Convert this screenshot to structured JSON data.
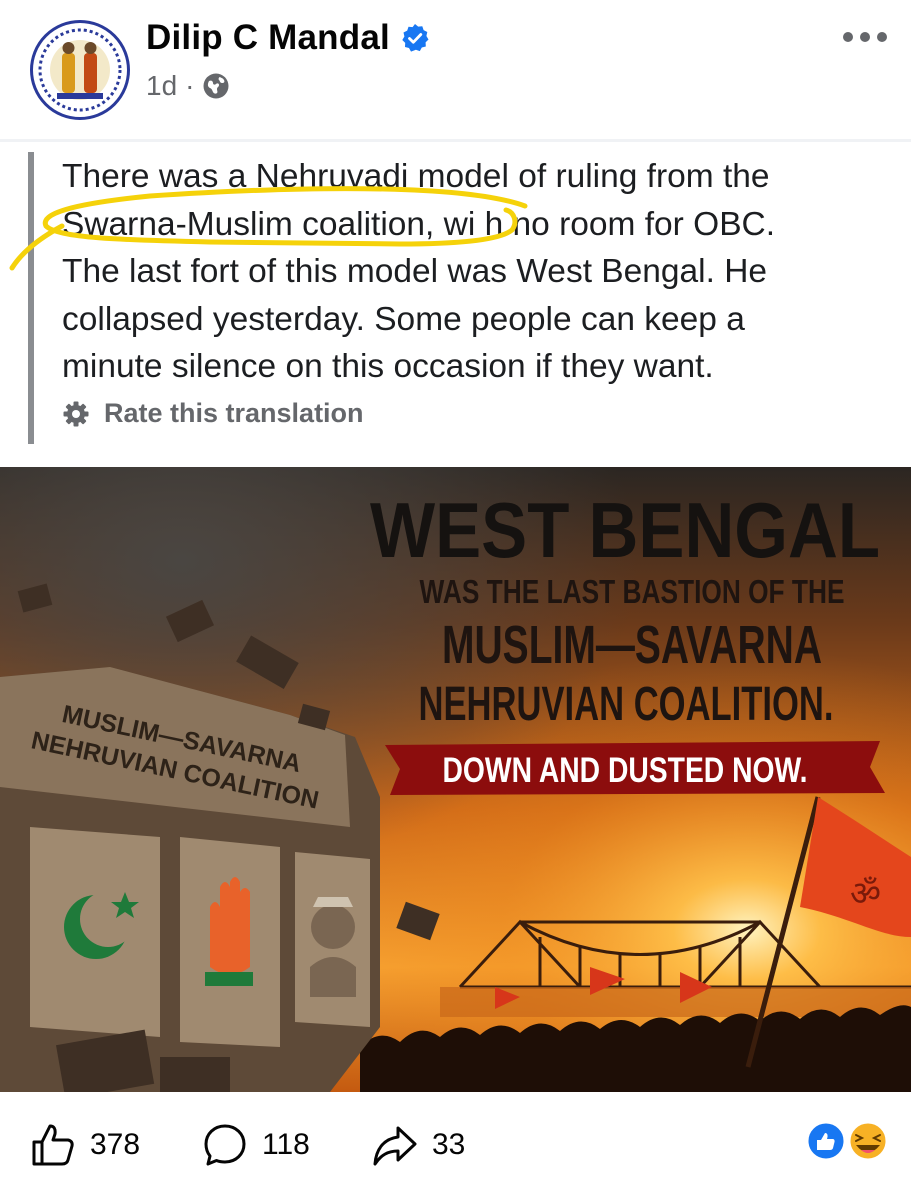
{
  "post": {
    "author": "Dilip C Mandal",
    "time": "1d",
    "separator": "·",
    "text_lines": [
      "There was a Nehruvadi model of ruling from the",
      "Swarna-Muslim coalition, wi h no room for OBC.",
      "The last fort of this model was West Bengal. He",
      "collapsed yesterday. Some people can keep a",
      "minute silence on this occasion if they want."
    ],
    "rate_translation": "Rate this translation"
  },
  "image": {
    "title": "WEST BENGAL",
    "line1": "WAS THE LAST BASTION OF THE",
    "line2": "MUSLIM—SAVARNA",
    "line3": "NEHRUVIAN COALITION.",
    "banner": "DOWN AND DUSTED NOW.",
    "wall_line1": "MUSLIM—SAVARNA",
    "wall_line2": "NEHRUVIAN COALITION",
    "flag_symbol": "ॐ"
  },
  "footer": {
    "likes": "378",
    "comments": "118",
    "shares": "33"
  },
  "colors": {
    "accent": "#1877f2",
    "highlight": "#f5d20a",
    "banner": "#8c0d0d",
    "sky_orange": "#f08a1c"
  },
  "icons": [
    "verified-icon",
    "globe-icon",
    "more-icon",
    "gear-icon",
    "like-icon",
    "comment-icon",
    "share-icon",
    "like-reaction-icon",
    "haha-reaction-icon"
  ]
}
